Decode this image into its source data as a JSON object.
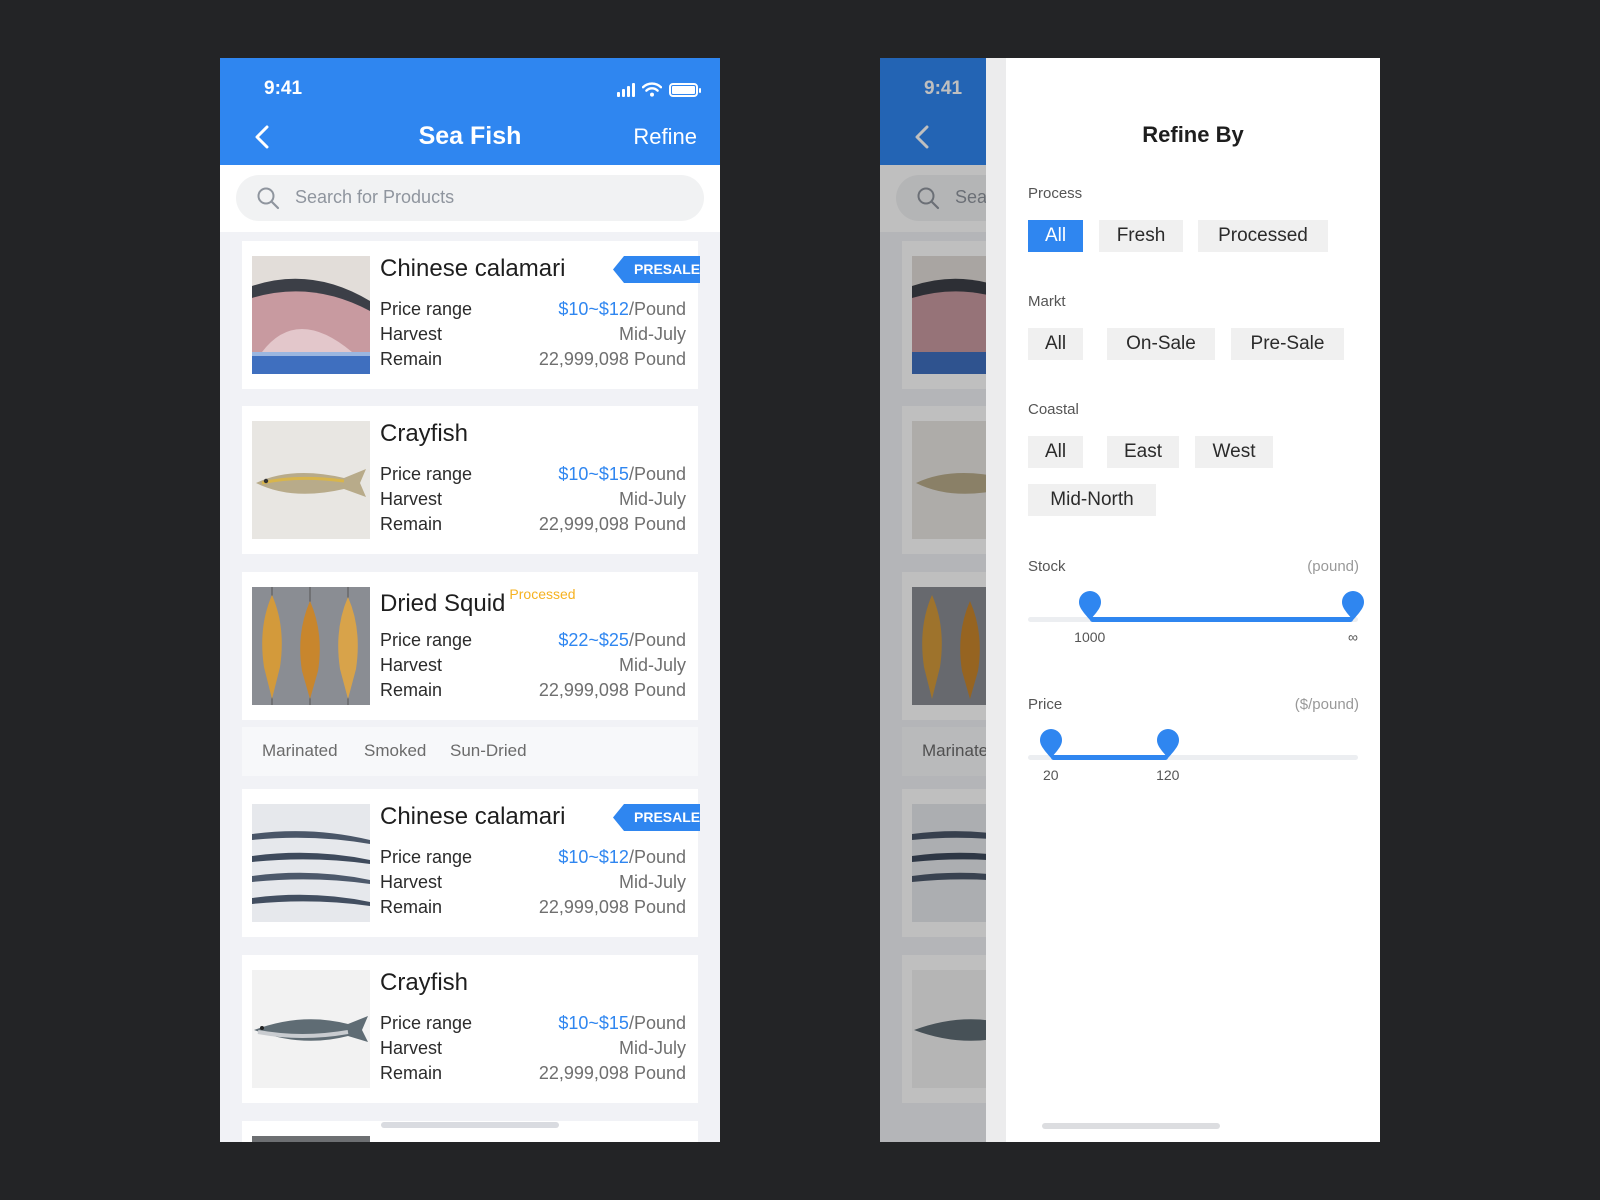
{
  "colors": {
    "accent": "#2f86f0",
    "processed_tag": "#f6b221",
    "canvas": "#232426"
  },
  "status_bar": {
    "time": "9:41"
  },
  "header": {
    "title": "Sea Fish",
    "refine_label": "Refine"
  },
  "search": {
    "placeholder": "Search for Products"
  },
  "labels": {
    "price_range": "Price range",
    "harvest": "Harvest",
    "remain": "Remain"
  },
  "products": [
    {
      "name": "Chinese calamari",
      "badge": "PRESALE",
      "price": "$10~$12",
      "unit": "/Pound",
      "harvest": "Mid-July",
      "remain": "22,999,098 Pound",
      "image": "fish-steak-image"
    },
    {
      "name": "Crayfish",
      "price": "$10~$15",
      "unit": "/Pound",
      "harvest": "Mid-July",
      "remain": "22,999,098 Pound",
      "image": "yellow-fish-image"
    },
    {
      "name": "Dried Squid",
      "tag": "Processed",
      "price": "$22~$25",
      "unit": "/Pound",
      "harvest": "Mid-July",
      "remain": "22,999,098 Pound",
      "image": "dried-fish-image"
    },
    {
      "name": "Chinese calamari",
      "badge": "PRESALE",
      "price": "$10~$12",
      "unit": "/Pound",
      "harvest": "Mid-July",
      "remain": "22,999,098 Pound",
      "image": "saury-fish-image"
    },
    {
      "name": "Crayfish",
      "price": "$10~$15",
      "unit": "/Pound",
      "harvest": "Mid-July",
      "remain": "22,999,098 Pound",
      "image": "mackerel-image"
    }
  ],
  "process_subtags": [
    "Marinated",
    "Smoked",
    "Sun-Dried"
  ],
  "refine_panel": {
    "title": "Refine By",
    "process": {
      "label": "Process",
      "options": [
        "All",
        "Fresh",
        "Processed"
      ],
      "selected": "All"
    },
    "market": {
      "label": "Markt",
      "options": [
        "All",
        "On-Sale",
        "Pre-Sale"
      ]
    },
    "coastal": {
      "label": "Coastal",
      "options": [
        "All",
        "East",
        "West",
        "Mid-North"
      ]
    },
    "stock": {
      "label": "Stock",
      "unit": "(pound)",
      "min_label": "1000",
      "max_label": "∞",
      "low_fraction": 0.19,
      "high_fraction": 1.0
    },
    "price": {
      "label": "Price",
      "unit": "($/pound)",
      "min_label": "20",
      "max_label": "120",
      "low_fraction": 0.07,
      "high_fraction": 0.43
    }
  }
}
